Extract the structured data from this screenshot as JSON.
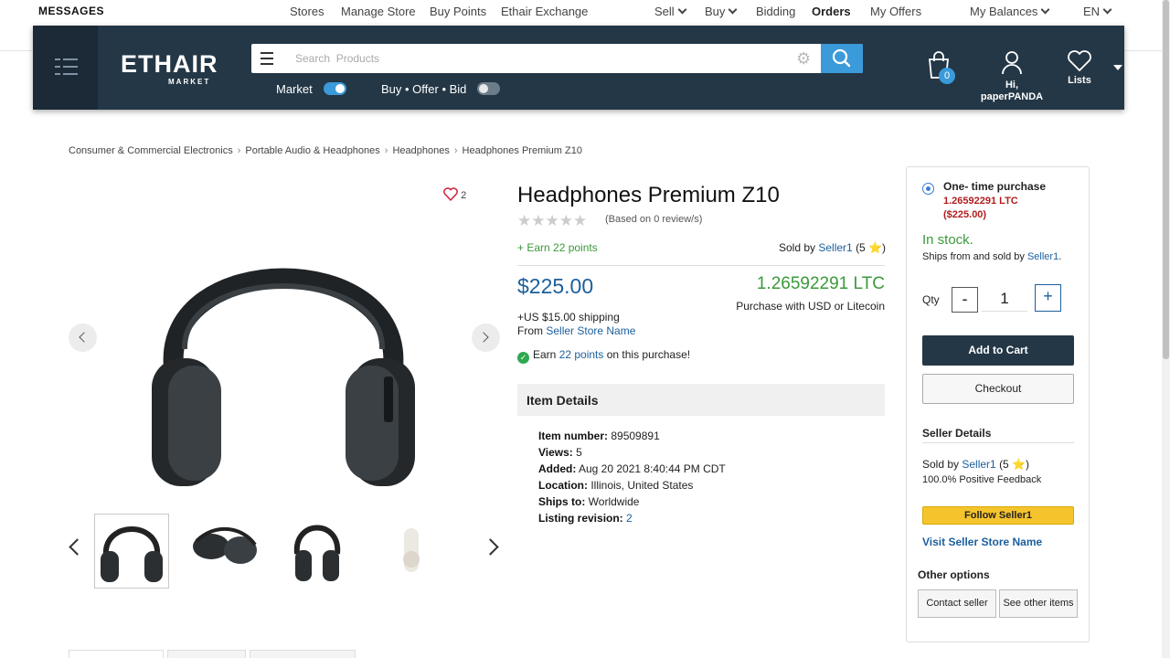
{
  "topbar": {
    "messages": "MESSAGES",
    "nav": [
      "Stores",
      "Manage Store",
      "Buy Points",
      "Ethair Exchange"
    ],
    "sell": "Sell",
    "buy": "Buy",
    "bidding": "Bidding",
    "orders": "Orders",
    "my_offers": "My Offers",
    "my_balances": "My Balances",
    "lang": "EN"
  },
  "header": {
    "logo_text": "ETHAIR",
    "logo_sub": "MARKET",
    "search_placeholder": "Search  Products",
    "toggle_market": "Market",
    "toggle_market_on": true,
    "toggle_bid": "Buy • Offer • Bid",
    "toggle_bid_on": false,
    "cart_count": "0",
    "user_greeting": "Hi,",
    "user_name": "paperPANDA",
    "lists": "Lists",
    "accent": "#3b9ad9"
  },
  "breadcrumb": [
    "Consumer & Commercial Electronics",
    "Portable Audio & Headphones",
    "Headphones",
    "Headphones Premium Z10"
  ],
  "gallery": {
    "favorites_count": "2",
    "thumbnails": [
      "headphones-front",
      "headphones-side",
      "headphones-angle",
      "headphones-white"
    ]
  },
  "product": {
    "title": "Headphones Premium Z10",
    "rating": 0,
    "reviews": "(Based on 0 review/s)",
    "earn_points": "+ Earn 22 points",
    "sold_by_label": "Sold by ",
    "seller": "Seller1",
    "seller_rating": "(5 ⭐)",
    "price_usd": "$225.00",
    "price_ltc": "1.26592291 LTC",
    "purchase_with": "Purchase with USD or Litecoin",
    "shipping": "+US $15.00 shipping",
    "from_label": "From ",
    "store_name": "Seller Store Name",
    "earn_purchase_pre": "Earn ",
    "earn_purchase_points": "22 points",
    "earn_purchase_post": " on this purchase!"
  },
  "item_details": {
    "heading": "Item Details",
    "rows": [
      {
        "label": "Item number:",
        "value": " 89509891"
      },
      {
        "label": "Views:",
        "value": " 5"
      },
      {
        "label": "Added:",
        "value": " Aug 20 2021 8:40:44 PM CDT"
      },
      {
        "label": "Location:",
        "value": " Illinois, United States"
      },
      {
        "label": "Ships to:",
        "value": " Worldwide"
      },
      {
        "label": "Listing revision:",
        "value": "2"
      }
    ]
  },
  "buybox": {
    "option_label": "One- time purchase",
    "option_ltc": "1.26592291 LTC",
    "option_usd": "($225.00)",
    "stock": "In stock.",
    "ships_from": "Ships from and sold by ",
    "seller": "Seller1",
    "qty_label": "Qty",
    "qty_minus": "-",
    "qty_value": "1",
    "qty_plus": "+",
    "add_to_cart": "Add to Cart",
    "checkout": "Checkout",
    "seller_details_heading": "Seller Details",
    "sold_by_label": "Sold by ",
    "seller_rating": "(5 ⭐)",
    "feedback": "100.0% Positive Feedback",
    "follow": "Follow Seller1",
    "visit": "Visit Seller Store Name",
    "other_options": "Other options",
    "contact_seller": "Contact seller",
    "see_other": "See other items"
  }
}
